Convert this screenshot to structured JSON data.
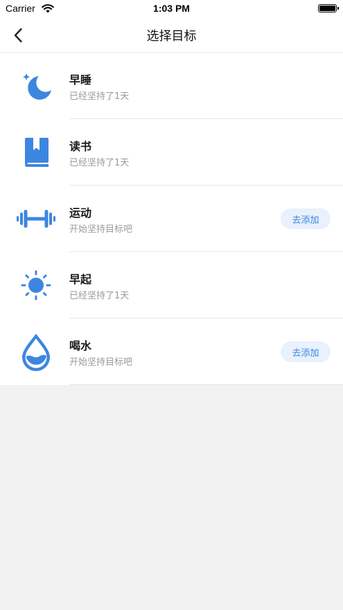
{
  "status_bar": {
    "carrier": "Carrier",
    "time": "1:03 PM"
  },
  "nav": {
    "title": "选择目标"
  },
  "theme": {
    "accent": "#3d86e0",
    "button_bg": "#e8f1fc"
  },
  "goals": [
    {
      "icon": "moon-stars-icon",
      "name": "早睡",
      "subtitle": "已经坚持了1天",
      "button": null
    },
    {
      "icon": "book-icon",
      "name": "读书",
      "subtitle": "已经坚持了1天",
      "button": null
    },
    {
      "icon": "dumbbell-icon",
      "name": "运动",
      "subtitle": "开始坚持目标吧",
      "button": "去添加"
    },
    {
      "icon": "sun-icon",
      "name": "早起",
      "subtitle": "已经坚持了1天",
      "button": null
    },
    {
      "icon": "water-drop-icon",
      "name": "喝水",
      "subtitle": "开始坚持目标吧",
      "button": "去添加"
    }
  ]
}
